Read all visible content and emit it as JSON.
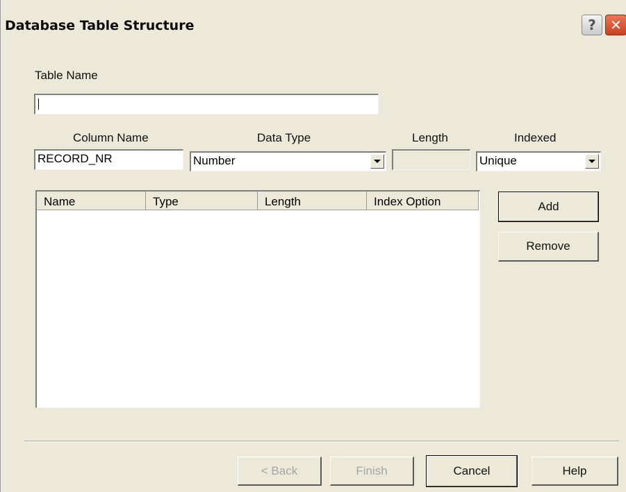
{
  "window": {
    "title": "Database Table Structure",
    "help_glyph": "?",
    "close_glyph": "✕"
  },
  "form": {
    "table_name_label": "Table Name",
    "table_name_value": "",
    "column_name_label": "Column Name",
    "column_name_value": "RECORD_NR",
    "data_type_label": "Data Type",
    "data_type_value": "Number",
    "length_label": "Length",
    "length_value": "",
    "indexed_label": "Indexed",
    "indexed_value": "Unique"
  },
  "columns_list": {
    "headers": [
      "Name",
      "Type",
      "Length",
      "Index Option"
    ],
    "rows": []
  },
  "buttons": {
    "add": "Add",
    "remove": "Remove",
    "back": "< Back",
    "finish": "Finish",
    "cancel": "Cancel",
    "help": "Help"
  },
  "colors": {
    "dialog_bg": "#ece9d8",
    "close_button": "#c9401f"
  },
  "icons": {
    "help": "help-icon",
    "close": "close-icon",
    "dropdown": "chevron-down-icon"
  }
}
